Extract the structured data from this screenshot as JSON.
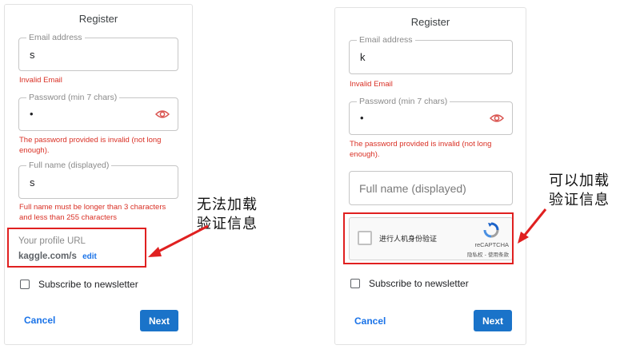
{
  "left_form": {
    "title": "Register",
    "email": {
      "label": "Email address",
      "value": "s",
      "error": "Invalid Email"
    },
    "password": {
      "label": "Password (min 7 chars)",
      "value": "•",
      "error_line1": "The password provided is invalid (not long",
      "error_line2": "enough)."
    },
    "fullname": {
      "label": "Full name (displayed)",
      "value": "s",
      "error_line1": "Full name must be longer than 3 characters",
      "error_line2": "and less than 255 characters"
    },
    "profile": {
      "label": "Your profile URL",
      "url": "kaggle.com/s",
      "edit": "edit"
    },
    "newsletter": "Subscribe to newsletter",
    "cancel": "Cancel",
    "next": "Next"
  },
  "right_form": {
    "title": "Register",
    "email": {
      "label": "Email address",
      "value": "k",
      "error": "Invalid Email"
    },
    "password": {
      "label": "Password (min 7 chars)",
      "value": "•",
      "error_line1": "The password provided is invalid (not long",
      "error_line2": "enough)."
    },
    "fullname": {
      "placeholder": "Full name (displayed)"
    },
    "recaptcha": {
      "checkbox_label": "进行人机身份验证",
      "brand": "reCAPTCHA",
      "links": "隐私权 - 使用条款"
    },
    "newsletter": "Subscribe to newsletter",
    "cancel": "Cancel",
    "next": "Next"
  },
  "annotations": {
    "left_line1": "无法加载",
    "left_line2": "验证信息",
    "right_line1": "可以加载",
    "right_line2": "验证信息"
  },
  "colors": {
    "error": "#d93025",
    "link": "#1a73e8",
    "next_button": "#1a73c9",
    "highlight_box": "#e02020",
    "eye_icon": "#d9534f"
  }
}
